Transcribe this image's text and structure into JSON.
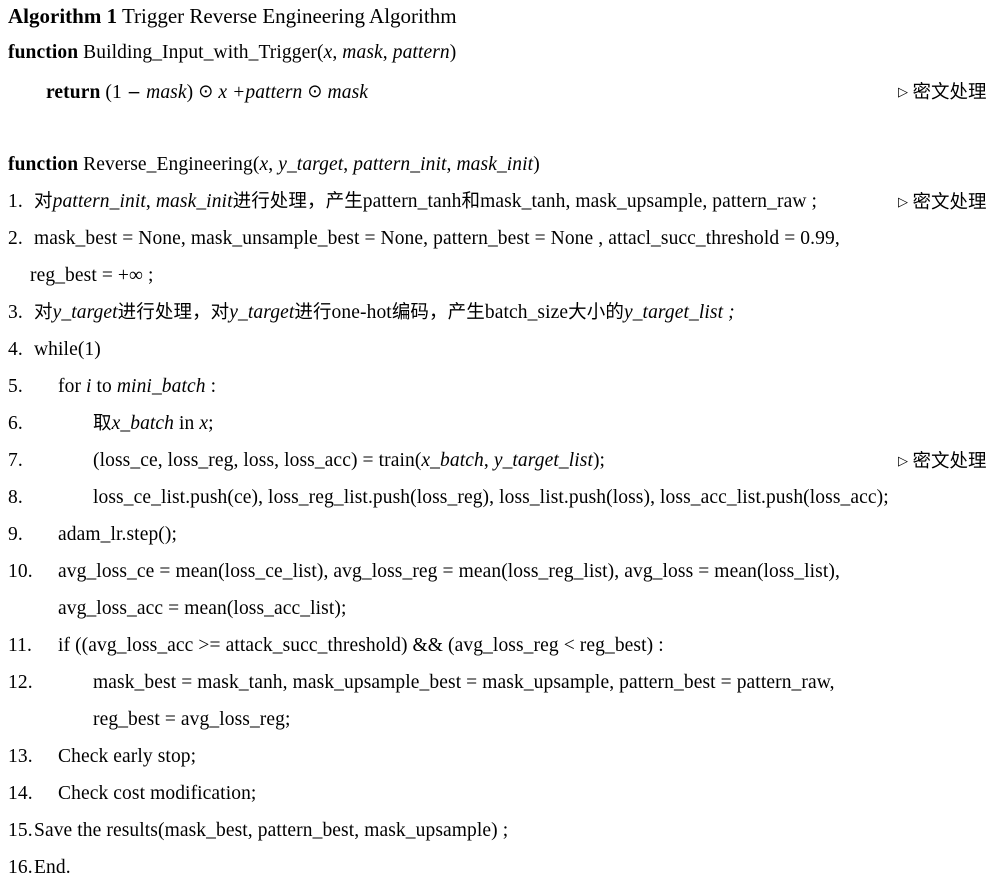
{
  "document": {
    "type": "algorithm-pseudocode-block",
    "background_color": "#ffffff",
    "text_color": "#000000"
  },
  "title": {
    "label_bold": "Algorithm 1",
    "label_rest": " Trigger Reverse Engineering Algorithm"
  },
  "annotations": {
    "marker": "▷",
    "text": "密文处理"
  },
  "function1": {
    "keyword": "function",
    "signature_plain": " Building_Input_with_Trigger(",
    "arg1": "x",
    "sep1": ", ",
    "arg2": "mask",
    "sep2": ", ",
    "arg3": "pattern",
    "close": ")",
    "return_keyword": "return",
    "return_body": " (1 − mask) ⊙ x + pattern ⊙ mask",
    "return_open": " (1 ",
    "return_minus": "−",
    "return_mask1": " mask",
    "return_close1": ") ",
    "odot1": "⊙",
    "return_x": " x +",
    "return_pattern": "pattern",
    "odot2": "⊙",
    "return_mask2": "mask"
  },
  "function2": {
    "keyword": "function",
    "name": " Reverse_Engineering(",
    "arg1": "x",
    "sep1": ", ",
    "arg2": "y_target",
    "sep2": ", ",
    "arg3": "pattern_init",
    "sep3": ", ",
    "arg4": "mask_init",
    "close": ")"
  },
  "steps": [
    {
      "num": "1.",
      "indent": 0,
      "parts": [
        {
          "t": "对",
          "s": "cjk"
        },
        {
          "t": "pattern_init",
          "s": "it"
        },
        {
          "t": ", ",
          "s": "plain"
        },
        {
          "t": "mask_init",
          "s": "it"
        },
        {
          "t": "进行处理，产生",
          "s": "cjk"
        },
        {
          "t": "pattern_tanh",
          "s": "plain"
        },
        {
          "t": "和",
          "s": "cjk"
        },
        {
          "t": "mask_tanh, mask_upsample, pattern_raw ;",
          "s": "plain"
        }
      ],
      "comment": true
    },
    {
      "num": "2.",
      "indent": 0,
      "parts": [
        {
          "t": "mask_best = None, mask_unsample_best = None, pattern_best = None , attacl_succ_threshold = 0.99,",
          "s": "plain"
        }
      ],
      "comment": false
    },
    {
      "num": "",
      "indent": 0,
      "cont": true,
      "parts": [
        {
          "t": "reg_best = +∞ ;",
          "s": "plain"
        }
      ],
      "comment": false
    },
    {
      "num": "3.",
      "indent": 0,
      "parts": [
        {
          "t": "对",
          "s": "cjk"
        },
        {
          "t": "y_target",
          "s": "it"
        },
        {
          "t": "进行处理，对",
          "s": "cjk"
        },
        {
          "t": "y_target",
          "s": "it"
        },
        {
          "t": "进行",
          "s": "cjk"
        },
        {
          "t": "one-hot",
          "s": "plain"
        },
        {
          "t": "编码，产生",
          "s": "cjk"
        },
        {
          "t": "batch_size",
          "s": "plain"
        },
        {
          "t": "大小的",
          "s": "cjk"
        },
        {
          "t": "y_target_list ;",
          "s": "it"
        }
      ],
      "comment": false
    },
    {
      "num": "4.",
      "indent": 0,
      "parts": [
        {
          "t": "while(1)",
          "s": "plain"
        }
      ],
      "comment": false
    },
    {
      "num": "5.",
      "indent": 1,
      "parts": [
        {
          "t": "for ",
          "s": "plain"
        },
        {
          "t": "i",
          "s": "it"
        },
        {
          "t": " to ",
          "s": "plain"
        },
        {
          "t": "mini_batch",
          "s": "it"
        },
        {
          "t": " :",
          "s": "plain"
        }
      ],
      "comment": false
    },
    {
      "num": "6.",
      "indent": 2,
      "parts": [
        {
          "t": "取",
          "s": "cjk"
        },
        {
          "t": "x_batch",
          "s": "it"
        },
        {
          "t": " in ",
          "s": "plain"
        },
        {
          "t": "x",
          "s": "it"
        },
        {
          "t": ";",
          "s": "plain"
        }
      ],
      "comment": false
    },
    {
      "num": "7.",
      "indent": 2,
      "parts": [
        {
          "t": "(loss_ce, loss_reg, loss, loss_acc) = train(",
          "s": "plain"
        },
        {
          "t": "x_batch",
          "s": "it"
        },
        {
          "t": ", ",
          "s": "plain"
        },
        {
          "t": "y_target_list",
          "s": "it"
        },
        {
          "t": ");",
          "s": "plain"
        }
      ],
      "comment": true
    },
    {
      "num": "8.",
      "indent": 2,
      "parts": [
        {
          "t": "loss_ce_list.push(ce), loss_reg_list.push(loss_reg), loss_list.push(loss), loss_acc_list.push(loss_acc);",
          "s": "plain"
        }
      ],
      "comment": false
    },
    {
      "num": "9.",
      "indent": 1,
      "parts": [
        {
          "t": "adam_lr.step();",
          "s": "plain"
        }
      ],
      "comment": false
    },
    {
      "num": "10.",
      "indent": 1,
      "parts": [
        {
          "t": "avg_loss_ce = mean(loss_ce_list), avg_loss_reg = mean(loss_reg_list), avg_loss = mean(loss_list),",
          "s": "plain"
        }
      ],
      "comment": false
    },
    {
      "num": "",
      "indent": 1,
      "cont": true,
      "parts": [
        {
          "t": "avg_loss_acc = mean(loss_acc_list);",
          "s": "plain"
        }
      ],
      "comment": false
    },
    {
      "num": "11.",
      "indent": 1,
      "parts": [
        {
          "t": "if ((avg_loss_acc >= attack_succ_threshold) && (avg_loss_reg < reg_best) :",
          "s": "plain"
        }
      ],
      "comment": false
    },
    {
      "num": "12.",
      "indent": 2,
      "parts": [
        {
          "t": "mask_best = mask_tanh, mask_upsample_best = mask_upsample, pattern_best = pattern_raw,",
          "s": "plain"
        }
      ],
      "comment": false
    },
    {
      "num": "",
      "indent": 2,
      "cont": true,
      "parts": [
        {
          "t": "reg_best = avg_loss_reg;",
          "s": "plain"
        }
      ],
      "comment": false
    },
    {
      "num": "13.",
      "indent": 1,
      "parts": [
        {
          "t": "Check early stop;",
          "s": "plain"
        }
      ],
      "comment": false
    },
    {
      "num": "14.",
      "indent": 1,
      "parts": [
        {
          "t": "Check cost modification;",
          "s": "plain"
        }
      ],
      "comment": false
    },
    {
      "num": "15.",
      "indent": 0,
      "parts": [
        {
          "t": "Save the results(mask_best, pattern_best, mask_upsample) ;",
          "s": "plain"
        }
      ],
      "comment": false
    },
    {
      "num": "16.",
      "indent": 0,
      "parts": [
        {
          "t": "End.",
          "s": "plain"
        }
      ],
      "comment": false
    }
  ]
}
